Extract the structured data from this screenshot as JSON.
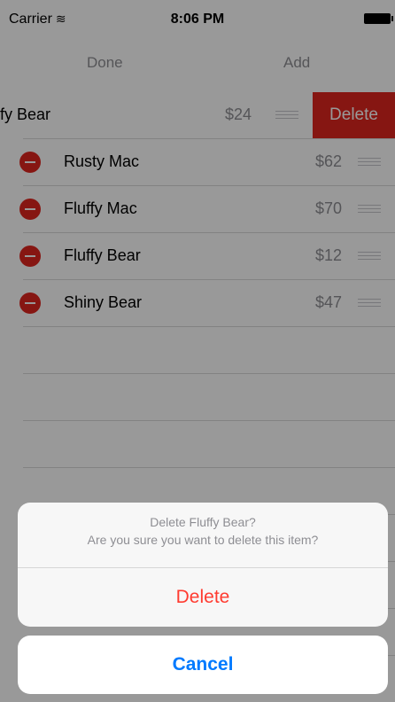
{
  "status_bar": {
    "carrier": "Carrier",
    "time": "8:06 PM"
  },
  "nav": {
    "left_button": "Done",
    "right_button": "Add"
  },
  "swiped_row": {
    "name": "fy Bear",
    "price": "$24",
    "delete_action": "Delete"
  },
  "items": [
    {
      "name": "Rusty Mac",
      "price": "$62"
    },
    {
      "name": "Fluffy Mac",
      "price": "$70"
    },
    {
      "name": "Fluffy Bear",
      "price": "$12"
    },
    {
      "name": "Shiny Bear",
      "price": "$47"
    }
  ],
  "action_sheet": {
    "title": "Delete Fluffy Bear?",
    "message": "Are you sure you want to delete this item?",
    "destructive_label": "Delete",
    "cancel_label": "Cancel"
  },
  "colors": {
    "destructive": "#e0251f",
    "accent": "#007aff"
  }
}
